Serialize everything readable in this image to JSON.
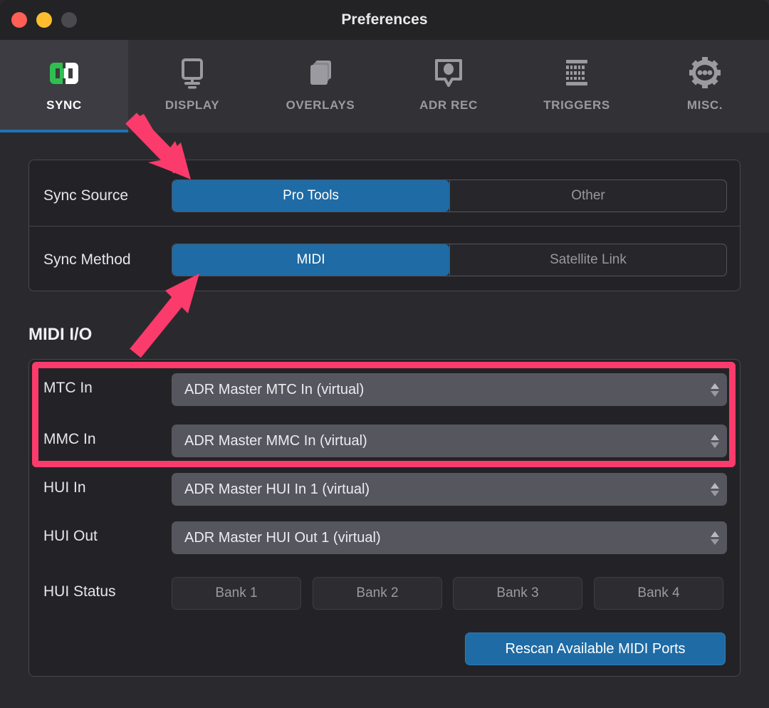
{
  "window": {
    "title": "Preferences",
    "traffic_lights": [
      "close-button",
      "minimize-button",
      "zoom-button"
    ]
  },
  "toolbar": {
    "items": [
      {
        "label": "SYNC",
        "icon": "sync-icon",
        "active": true
      },
      {
        "label": "DISPLAY",
        "icon": "display-icon",
        "active": false
      },
      {
        "label": "OVERLAYS",
        "icon": "overlays-icon",
        "active": false
      },
      {
        "label": "ADR REC",
        "icon": "adr-rec-icon",
        "active": false
      },
      {
        "label": "TRIGGERS",
        "icon": "midi-icon",
        "active": false
      },
      {
        "label": "MISC.",
        "icon": "gear-icon",
        "active": false
      }
    ]
  },
  "sync_panel": {
    "sync_source": {
      "label": "Sync Source",
      "options": [
        "Pro Tools",
        "Other"
      ],
      "selected": "Pro Tools"
    },
    "sync_method": {
      "label": "Sync Method",
      "options": [
        "MIDI",
        "Satellite Link"
      ],
      "selected": "MIDI"
    }
  },
  "midi_io": {
    "section_title": "MIDI I/O",
    "rows": [
      {
        "label": "MTC In",
        "value": "ADR Master MTC In (virtual)"
      },
      {
        "label": "MMC In",
        "value": "ADR Master MMC In (virtual)"
      },
      {
        "label": "HUI In",
        "value": "ADR Master HUI In 1 (virtual)"
      },
      {
        "label": "HUI Out",
        "value": "ADR Master HUI Out 1 (virtual)"
      }
    ],
    "hui_status": {
      "label": "HUI Status",
      "banks": [
        "Bank 1",
        "Bank 2",
        "Bank 3",
        "Bank 4"
      ]
    },
    "rescan_button": "Rescan Available MIDI Ports"
  },
  "annotations": {
    "highlight_color": "#fb3b6b",
    "arrow_to_sync_source": "arrow-pointing-to-sync-source",
    "arrow_to_sync_method": "arrow-pointing-to-sync-method",
    "box_around_mtc_mmc": "highlight-box-mtc-mmc-rows"
  },
  "colors": {
    "accent_blue": "#1f6ba5",
    "annotation_pink": "#fb3b6b",
    "window_bg": "#2a2a2e",
    "panel_bg": "#232327"
  }
}
